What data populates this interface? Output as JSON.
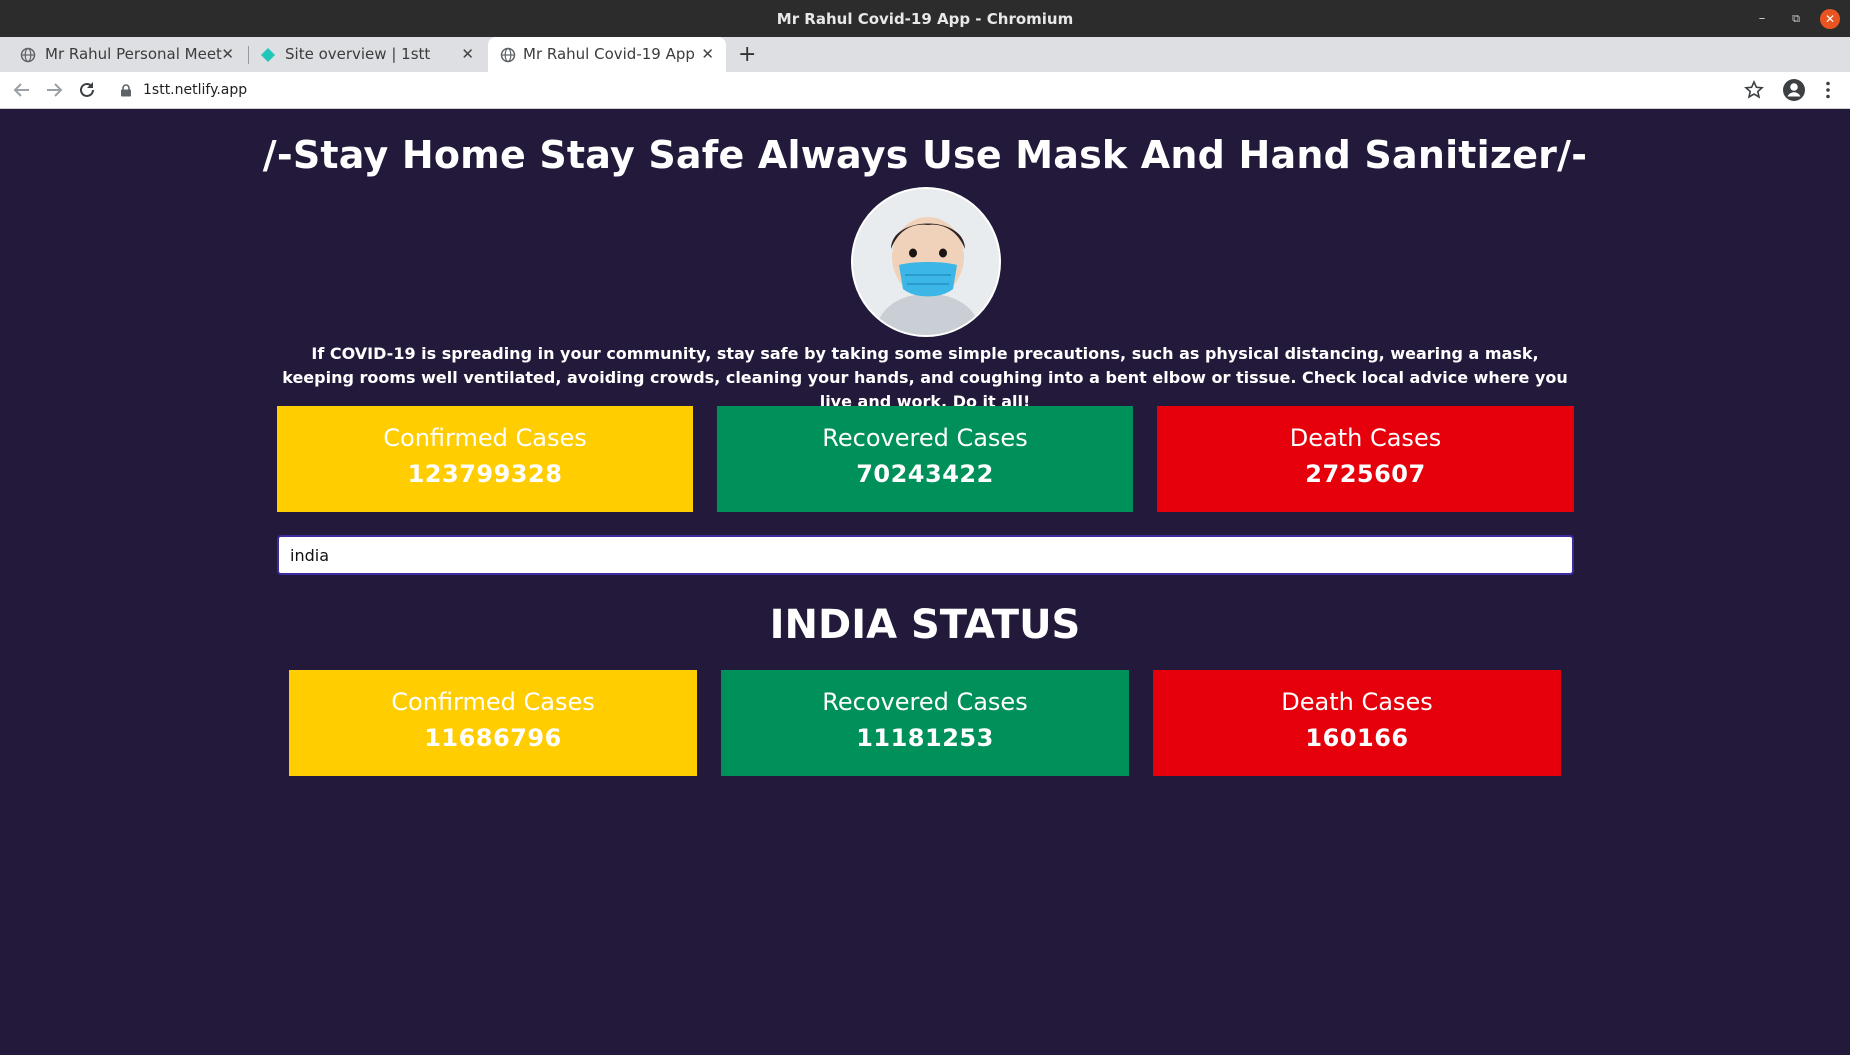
{
  "window": {
    "title": "Mr Rahul Covid-19 App - Chromium"
  },
  "tabs": [
    {
      "label": "Mr Rahul Personal Meet",
      "active": false
    },
    {
      "label": "Site overview | 1stt",
      "active": false
    },
    {
      "label": "Mr Rahul Covid-19 App",
      "active": true
    }
  ],
  "address_bar": {
    "url": "1stt.netlify.app"
  },
  "page": {
    "headline": "/-Stay Home Stay Safe Always Use Mask And Hand Sanitizer/-",
    "advice": "If COVID-19 is spreading in your community, stay safe by taking some simple precautions, such as physical distancing, wearing a mask, keeping rooms well ventilated, avoiding crowds, cleaning your hands, and coughing into a bent elbow or tissue. Check local advice where you live and work. Do it all!",
    "global_stats": [
      {
        "label": "Confirmed Cases",
        "value": "123799328",
        "color": "#ffcd00"
      },
      {
        "label": "Recovered Cases",
        "value": "70243422",
        "color": "#00915a"
      },
      {
        "label": "Death Cases",
        "value": "2725607",
        "color": "#e6000c"
      }
    ],
    "search": {
      "value": "india",
      "placeholder": ""
    },
    "country_title": "INDIA STATUS",
    "country_stats": [
      {
        "label": "Confirmed Cases",
        "value": "11686796",
        "color": "#ffcd00"
      },
      {
        "label": "Recovered Cases",
        "value": "11181253",
        "color": "#00915a"
      },
      {
        "label": "Death Cases",
        "value": "160166",
        "color": "#e6000c"
      }
    ]
  },
  "icons": {
    "favicon_1": "globe-icon",
    "favicon_2": "netlify-diamond-icon",
    "favicon_3": "globe-icon",
    "nav_back": "arrow-left-icon",
    "nav_forward": "arrow-right-icon",
    "nav_reload": "reload-icon",
    "secure": "lock-icon",
    "bookmark": "star-icon",
    "profile": "account-icon",
    "menu": "kebab-menu-icon"
  }
}
